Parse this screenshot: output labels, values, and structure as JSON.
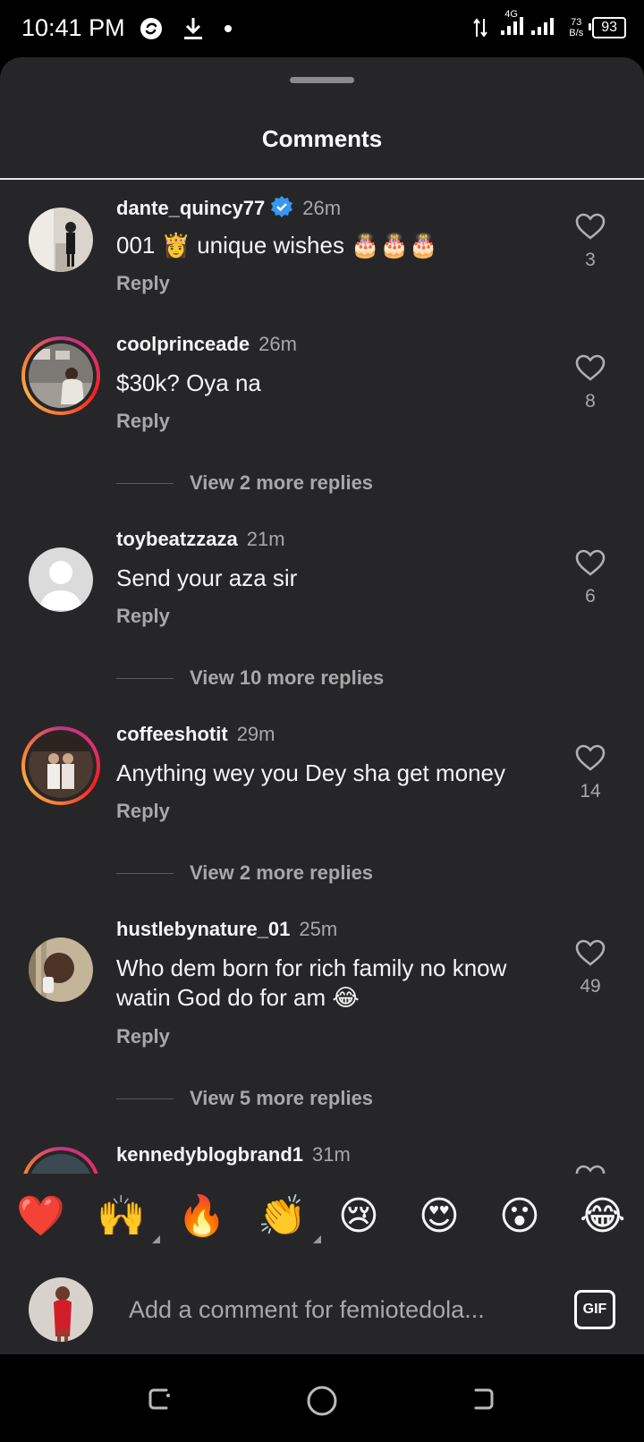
{
  "status_bar": {
    "time": "10:41 PM",
    "network_type": "4G",
    "net_speed_value": "73",
    "net_speed_unit": "B/s",
    "battery": "93"
  },
  "sheet": {
    "title": "Comments"
  },
  "comments": [
    {
      "username": "dante_quincy77",
      "verified": true,
      "time": "26m",
      "text": "001 👸 unique wishes 🎂🎂🎂",
      "reply_label": "Reply",
      "likes": "3"
    },
    {
      "username": "coolprinceade",
      "verified": false,
      "time": "26m",
      "text": "$30k? Oya na",
      "reply_label": "Reply",
      "likes": "8",
      "view_more": "View 2 more replies"
    },
    {
      "username": "toybeatzzaza",
      "verified": false,
      "time": "21m",
      "text": "Send your aza sir",
      "reply_label": "Reply",
      "likes": "6",
      "view_more": "View 10 more replies"
    },
    {
      "username": "coffeeshotit",
      "verified": false,
      "time": "29m",
      "text": "Anything wey you Dey sha get money",
      "reply_label": "Reply",
      "likes": "14",
      "view_more": "View 2 more replies"
    },
    {
      "username": "hustlebynature_01",
      "verified": false,
      "time": "25m",
      "text": "Who dem born for rich family no know watin God do for am 😂",
      "reply_label": "Reply",
      "likes": "49",
      "view_more": "View 5 more replies"
    },
    {
      "username": "kennedyblogbrand1",
      "verified": false,
      "time": "31m"
    }
  ],
  "quick_reactions": [
    "❤️",
    "🙌",
    "🔥",
    "👏",
    "😢",
    "😍",
    "😮",
    "😂"
  ],
  "composer": {
    "placeholder": "Add a comment for femiotedola...",
    "gif_label": "GIF"
  },
  "colors": {
    "sheet_bg": "#262628",
    "verified_blue": "#3897f0",
    "muted_text": "#a8a8a8"
  }
}
